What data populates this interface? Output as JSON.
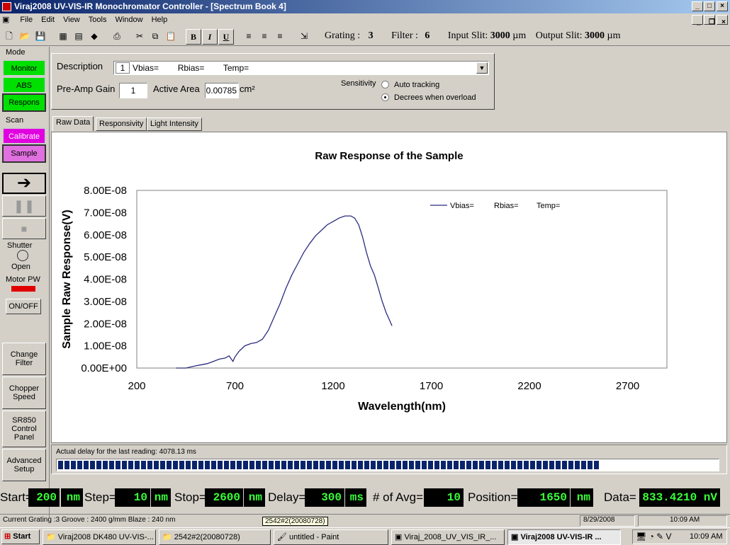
{
  "window": {
    "title": "Viraj2008 UV-VIS-IR Monochromator Controller - [Spectrum Book 4]"
  },
  "menu": [
    "File",
    "Edit",
    "View",
    "Tools",
    "Window",
    "Help"
  ],
  "toolbar": {
    "grating_label": "Grating :",
    "grating_value": "3",
    "filter_label": "Filter :",
    "filter_value": "6",
    "input_slit_label": "Input Slit:",
    "input_slit_value": "3000",
    "output_slit_label": "Output Slit:",
    "output_slit_value": "3000",
    "slit_unit": "µm",
    "bold": "B",
    "italic": "I",
    "underline": "U"
  },
  "sidebar": {
    "mode_label": "Mode",
    "monitor": "Monitor",
    "abs": "ABS",
    "respons": "Respons",
    "scan_label": "Scan",
    "calibrate": "Calibrate",
    "sample": "Sample",
    "shutter_label": "Shutter",
    "shutter_state": "Open",
    "motor_label": "Motor PW",
    "onoff": "ON/OFF",
    "change_filter": "Change Filter",
    "chopper_speed": "Chopper Speed",
    "sr850": "SR850 Control Panel",
    "advanced": "Advanced Setup"
  },
  "form": {
    "description_label": "Description",
    "description_index": "1",
    "description_value": "Vbias=        Rbias=        Temp=",
    "preamp_label": "Pre-Amp Gain",
    "preamp_value": "1",
    "area_label": "Active Area",
    "area_value": "0.00785",
    "area_unit": "cm²",
    "sensitivity_label": "Sensitivity",
    "opt_auto": "Auto tracking",
    "opt_decrease": "Decrees when overload"
  },
  "tabs": [
    "Raw Data",
    "Responsivity",
    "Light Intensity"
  ],
  "chart_data": {
    "type": "line",
    "title": "Raw Response of the Sample",
    "xlabel": "Wavelength(nm)",
    "ylabel": "Sample Raw Response(V)",
    "xlim": [
      200,
      2900
    ],
    "ylim": [
      0,
      8e-08
    ],
    "xticks": [
      "200",
      "700",
      "1200",
      "1700",
      "2200",
      "2700"
    ],
    "yticks": [
      "0.00E+00",
      "1.00E-08",
      "2.00E-08",
      "3.00E-08",
      "4.00E-08",
      "5.00E-08",
      "6.00E-08",
      "7.00E-08",
      "8.00E-08"
    ],
    "legend": "top-right",
    "legend_labels": [
      "Vbias=",
      "Rbias=",
      "Temp="
    ],
    "series": [
      {
        "color": "#2b2b7f",
        "x": [
          400,
          450,
          500,
          530,
          560,
          590,
          620,
          650,
          670,
          690,
          700,
          720,
          750,
          780,
          810,
          840,
          870,
          900,
          930,
          960,
          990,
          1020,
          1050,
          1080,
          1110,
          1140,
          1170,
          1200,
          1230,
          1260,
          1290,
          1310,
          1330,
          1350,
          1370,
          1390,
          1410,
          1430,
          1450,
          1470,
          1490,
          1500
        ],
        "y": [
          0,
          0,
          1e-09,
          1.5e-09,
          2e-09,
          3e-09,
          4e-09,
          4.5e-09,
          5.5e-09,
          3e-09,
          5e-09,
          7.5e-09,
          1e-08,
          1.1e-08,
          1.15e-08,
          1.3e-08,
          1.7e-08,
          2.3e-08,
          2.9e-08,
          3.6e-08,
          4.2e-08,
          4.7e-08,
          5.2e-08,
          5.6e-08,
          5.95e-08,
          6.2e-08,
          6.45e-08,
          6.6e-08,
          6.75e-08,
          6.85e-08,
          6.85e-08,
          6.75e-08,
          6.45e-08,
          5.9e-08,
          5.2e-08,
          4.6e-08,
          4.2e-08,
          3.6e-08,
          3e-08,
          2.5e-08,
          2.1e-08,
          1.9e-08
        ]
      }
    ]
  },
  "status": {
    "delay_text": "Actual delay for the  last reading:  4078.13 ms",
    "progress": 0.82,
    "grating_info": "Current Grating :3  Groove : 2400 g/mm  Blaze : 240 nm",
    "tooltip": "2542#2(20080728)",
    "date": "8/29/2008",
    "time": "10:09 AM"
  },
  "params": {
    "start_label": "Start=",
    "start": "200",
    "step_label": "Step=",
    "step": "10",
    "stop_label": "Stop=",
    "stop": "2600",
    "delay_label": "Delay=",
    "delay": "300",
    "avg_label": "# of Avg=",
    "avg": "10",
    "position_label": "Position=",
    "position": "1650",
    "data_label": "Data=",
    "data": "833.4210 nV",
    "nm": "nm",
    "ms": "ms"
  },
  "taskbar": {
    "start": "Start",
    "items": [
      "Viraj2008 DK480 UV-VIS-...",
      "2542#2(20080728)",
      "untitled - Paint",
      "Viraj_2008_UV_VIS_IR_...",
      "Viraj2008 UV-VIS-IR ..."
    ],
    "clock": "10:09 AM"
  }
}
